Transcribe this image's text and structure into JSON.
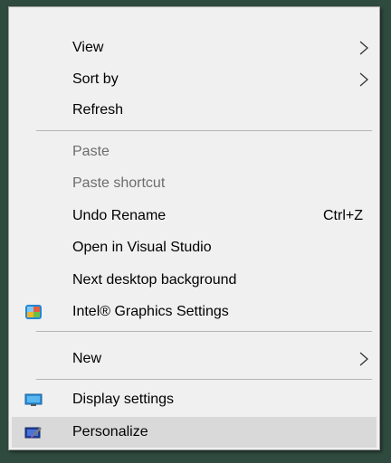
{
  "menu": {
    "items": [
      {
        "label": "View"
      },
      {
        "label": "Sort by"
      },
      {
        "label": "Refresh"
      },
      {
        "label": "Paste"
      },
      {
        "label": "Paste shortcut"
      },
      {
        "label": "Undo Rename",
        "shortcut": "Ctrl+Z"
      },
      {
        "label": "Open in Visual Studio"
      },
      {
        "label": "Next desktop background"
      },
      {
        "label": "Intel® Graphics Settings",
        "icon": "intel-graphics-icon"
      },
      {
        "label": "New"
      },
      {
        "label": "Display settings",
        "icon": "display-settings-icon"
      },
      {
        "label": "Personalize",
        "icon": "personalize-icon"
      }
    ]
  },
  "colors": {
    "menu_background": "#f0f0f0",
    "highlight": "#d9d9d9",
    "disabled_text": "#6d6d6d",
    "desktop_background": "#2f4a3e"
  }
}
